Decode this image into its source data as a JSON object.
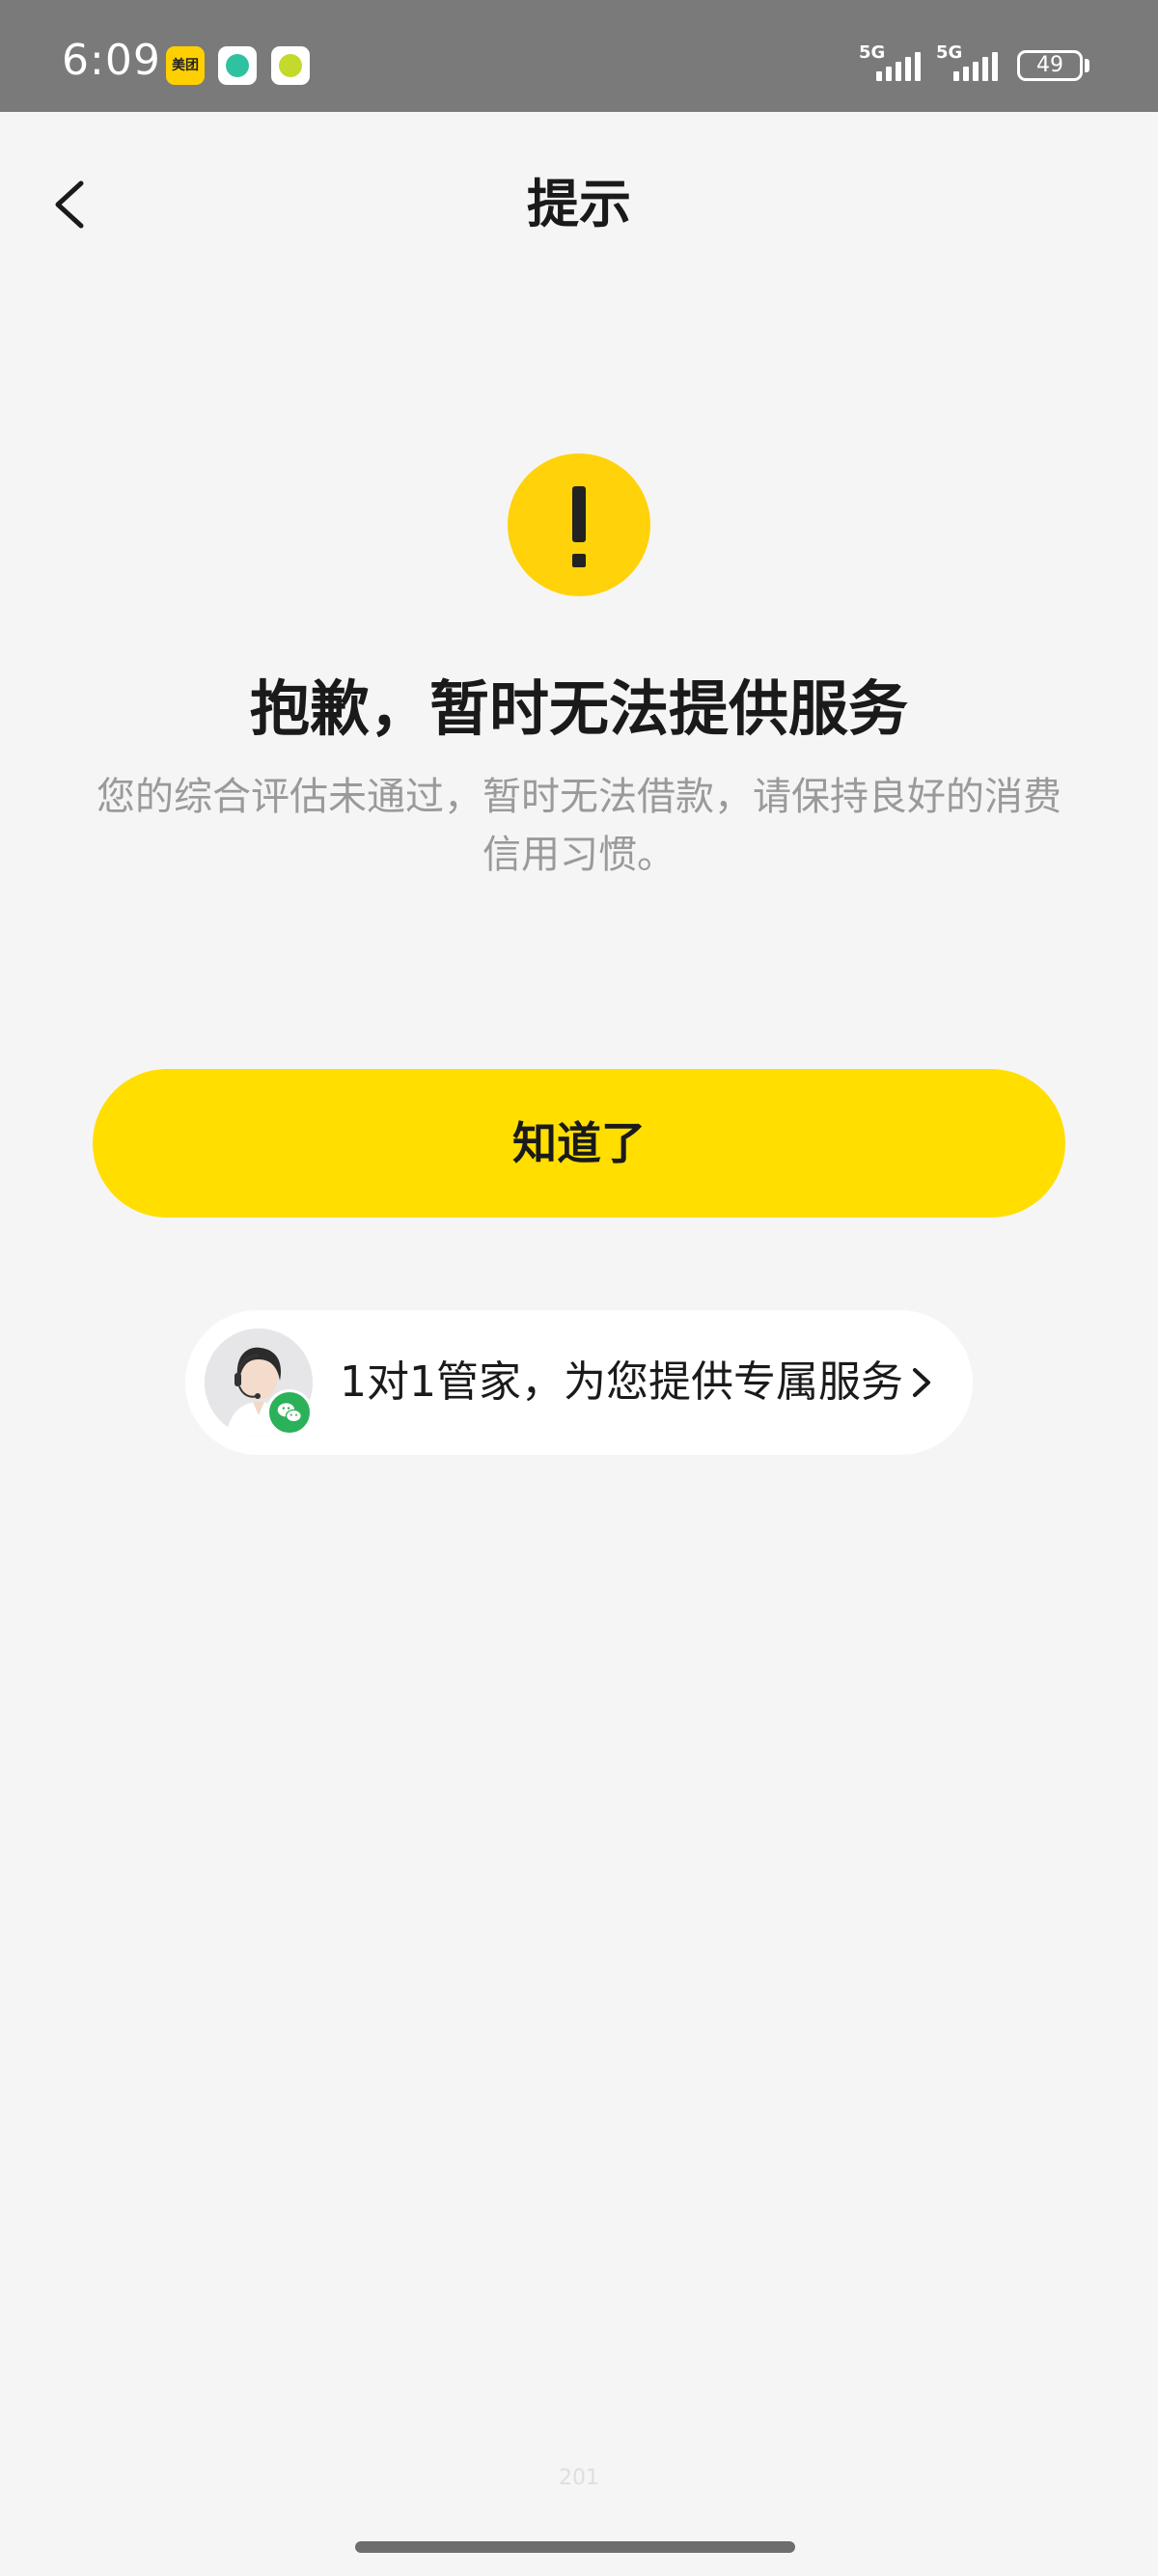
{
  "status_bar": {
    "time": "6:09",
    "app_icons": [
      "meituan-icon",
      "app-icon-2",
      "app-icon-3"
    ],
    "meituan_label": "美团",
    "network_1": "5G",
    "network_2": "5G",
    "battery": "49"
  },
  "nav": {
    "back_icon": "chevron-left-icon",
    "title": "提示"
  },
  "main": {
    "icon": "exclamation-icon",
    "icon_color": "#ffd20a",
    "headline": "抱歉，暂时无法提供服务",
    "description": "您的综合评估未通过，暂时无法借款，请保持良好的消费信用习惯。",
    "primary_button_label": "知道了",
    "primary_button_color": "#ffde00"
  },
  "advisor": {
    "text": "1对1管家，为您提供专属服务",
    "badge_icon": "wechat-icon",
    "badge_color": "#2bb15a"
  },
  "footer": {
    "number": "201"
  }
}
